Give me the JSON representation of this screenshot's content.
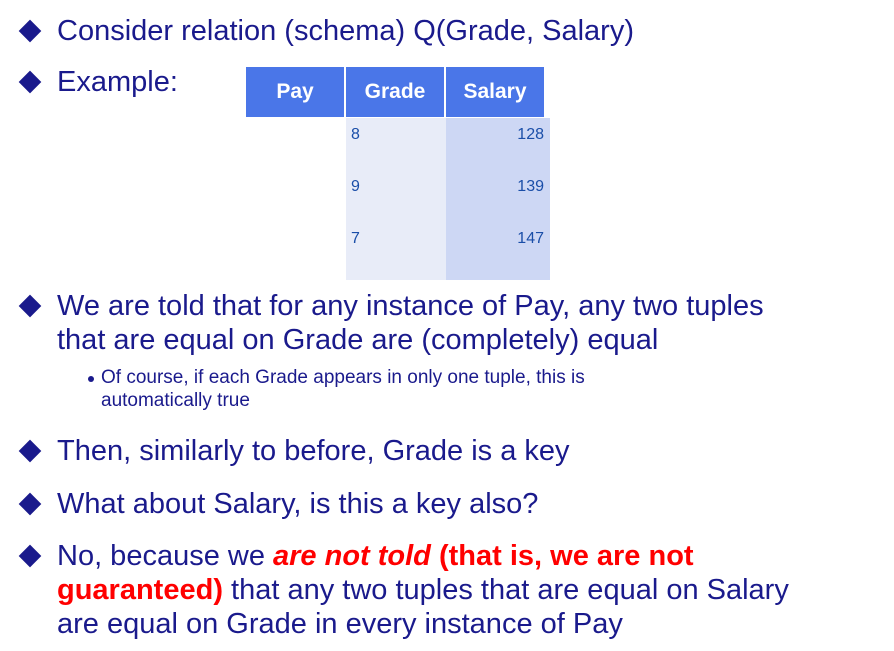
{
  "bullets": {
    "b1": "Consider relation (schema) Q(Grade, Salary)",
    "b2": "Example:",
    "b3_line1": "We are told that for any instance of Pay, any two tuples",
    "b3_line2": "that are equal on Grade are (completely) equal",
    "sub1_line1": "Of course, if each Grade appears in only one tuple, this is",
    "sub1_line2": "automatically true",
    "b4": "Then, similarly to before, Grade is a key",
    "b5": "What about Salary, is this a key also?",
    "b6_part1": "No, because we ",
    "b6_emph1": "are not told",
    "b6_emph2": " (that is, we are not",
    "b6_line2_emph": "guaranteed)",
    "b6_line2_rest": " that any two tuples that are equal on Salary",
    "b6_line3": "are equal on Grade in every instance of Pay"
  },
  "table": {
    "name": "Pay",
    "headers": [
      "Grade",
      "Salary"
    ],
    "rows": [
      {
        "grade": "8",
        "salary": "128"
      },
      {
        "grade": "9",
        "salary": "139"
      },
      {
        "grade": "7",
        "salary": "147"
      }
    ]
  },
  "colors": {
    "text": "#1a1a8c",
    "emphasis": "#ff0000",
    "header_bg": "#4a76e8",
    "grade_bg": "#e8ecf8",
    "salary_bg": "#cdd7f4"
  }
}
